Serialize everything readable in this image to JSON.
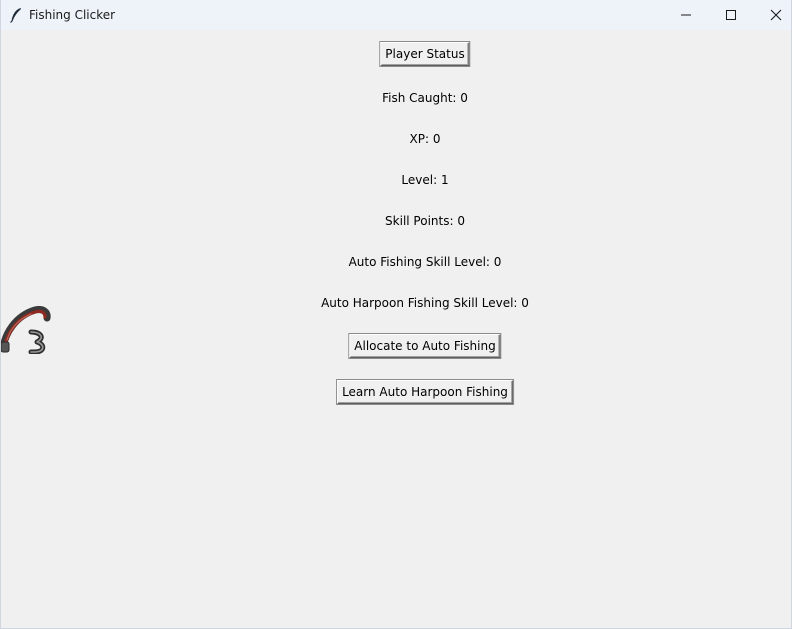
{
  "window": {
    "title": "Fishing Clicker",
    "controls": [
      "minimize",
      "maximize",
      "close"
    ]
  },
  "main": {
    "player_status_button": "Player Status",
    "fish_caught": "Fish Caught: 0",
    "xp": "XP: 0",
    "level": "Level: 1",
    "skill_points": "Skill Points: 0",
    "auto_fishing_skill": "Auto Fishing Skill Level: 0",
    "auto_harpoon_skill": "Auto Harpoon Fishing Skill Level: 0",
    "allocate_auto_fishing_button": "Allocate to Auto Fishing",
    "learn_auto_harpoon_button": "Learn Auto Harpoon Fishing"
  },
  "icons": {
    "app": "feather-icon",
    "rod": "fishing-rod-icon"
  }
}
